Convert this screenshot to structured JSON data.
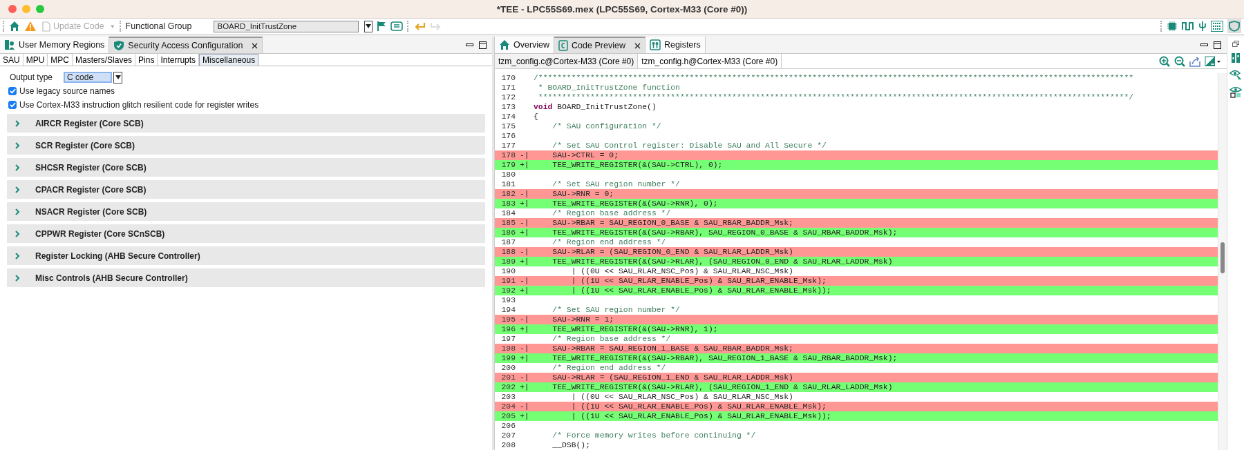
{
  "window": {
    "title": "*TEE - LPC55S69.mex (LPC55S69, Cortex-M33 (Core #0))"
  },
  "toolbar": {
    "update_code": {
      "label": "Update Code",
      "disabled": true,
      "caret": "▼"
    },
    "functional_group_label": "Functional Group",
    "functional_group": "BOARD_InitTrustZone"
  },
  "left_panel": {
    "tabs": [
      {
        "label": "User Memory Regions",
        "selected": false,
        "closable": false
      },
      {
        "label": "Security Access Configuration",
        "selected": true,
        "closable": true
      }
    ],
    "subtabs": [
      {
        "label": "SAU",
        "selected": false
      },
      {
        "label": "MPU",
        "selected": false
      },
      {
        "label": "MPC",
        "selected": false
      },
      {
        "label": "Masters/Slaves",
        "selected": false
      },
      {
        "label": "Pins",
        "selected": false
      },
      {
        "label": "Interrupts",
        "selected": false
      },
      {
        "label": "Miscellaneous",
        "selected": true
      }
    ],
    "output_type": {
      "label": "Output type",
      "value": "C code"
    },
    "options": [
      {
        "label": "Use legacy source names",
        "checked": true
      },
      {
        "label": "Use Cortex-M33 instruction glitch resilient code for register writes",
        "checked": true
      }
    ],
    "sections": [
      {
        "title": "AIRCR Register (Core SCB)",
        "expanded": false
      },
      {
        "title": "SCR Register (Core SCB)",
        "expanded": false
      },
      {
        "title": "SHCSR Register (Core SCB)",
        "expanded": false
      },
      {
        "title": "CPACR Register (Core SCB)",
        "expanded": false
      },
      {
        "title": "NSACR Register (Core SCB)",
        "expanded": false
      },
      {
        "title": "CPPWR Register (Core SCnSCB)",
        "expanded": false
      },
      {
        "title": "Register Locking (AHB Secure Controller)",
        "expanded": false
      },
      {
        "title": "Misc Controls (AHB Secure Controller)",
        "expanded": false
      }
    ]
  },
  "right_panel": {
    "tabs": [
      {
        "label": "Overview",
        "selected": false,
        "closable": false
      },
      {
        "label": "Code Preview",
        "selected": true,
        "closable": true
      },
      {
        "label": "Registers",
        "selected": false,
        "closable": false
      }
    ],
    "file_tabs": [
      {
        "label": "tzm_config.c@Cortex-M33 (Core #0)",
        "selected": true
      },
      {
        "label": "tzm_config.h@Cortex-M33 (Core #0)",
        "selected": false
      }
    ],
    "code_lines": [
      {
        "number": "170",
        "kind": "context",
        "comment": true,
        "code": "/******************************************************************************************************************************"
      },
      {
        "number": "171",
        "kind": "context",
        "comment": true,
        "code": " * BOARD_InitTrustZone function"
      },
      {
        "number": "172",
        "kind": "context",
        "comment": true,
        "code": " *****************************************************************************************************************************/"
      },
      {
        "number": "173",
        "kind": "context",
        "comment": false,
        "keyword": "void",
        "code": "BOARD_InitTrustZone()"
      },
      {
        "number": "174",
        "kind": "context",
        "comment": false,
        "code": "{"
      },
      {
        "number": "175",
        "kind": "context",
        "comment": true,
        "code": "    /* SAU configuration */"
      },
      {
        "number": "176",
        "kind": "context"
      },
      {
        "number": "177",
        "kind": "context",
        "comment": true,
        "code": "    /* Set SAU Control register: Disable SAU and All Secure */"
      },
      {
        "number": "178",
        "kind": "removed",
        "marker": "-|",
        "comment": false,
        "code": "    SAU->CTRL = 0;"
      },
      {
        "number": "179",
        "kind": "added",
        "marker": "+|",
        "comment": false,
        "code": "    TEE_WRITE_REGISTER(&(SAU->CTRL), 0);"
      },
      {
        "number": "180",
        "kind": "context"
      },
      {
        "number": "181",
        "kind": "context",
        "comment": true,
        "code": "    /* Set SAU region number */"
      },
      {
        "number": "182",
        "kind": "removed",
        "marker": "-|",
        "comment": false,
        "code": "    SAU->RNR = 0;"
      },
      {
        "number": "183",
        "kind": "added",
        "marker": "+|",
        "comment": false,
        "code": "    TEE_WRITE_REGISTER(&(SAU->RNR), 0);"
      },
      {
        "number": "184",
        "kind": "context",
        "comment": true,
        "code": "    /* Region base address */"
      },
      {
        "number": "185",
        "kind": "removed",
        "marker": "-|",
        "comment": false,
        "code": "    SAU->RBAR = SAU_REGION_0_BASE & SAU_RBAR_BADDR_Msk;"
      },
      {
        "number": "186",
        "kind": "added",
        "marker": "+|",
        "comment": false,
        "code": "    TEE_WRITE_REGISTER(&(SAU->RBAR), SAU_REGION_0_BASE & SAU_RBAR_BADDR_Msk);"
      },
      {
        "number": "187",
        "kind": "context",
        "comment": true,
        "code": "    /* Region end address */"
      },
      {
        "number": "188",
        "kind": "removed",
        "marker": "-|",
        "comment": false,
        "code": "    SAU->RLAR = (SAU_REGION_0_END & SAU_RLAR_LADDR_Msk)"
      },
      {
        "number": "189",
        "kind": "added",
        "marker": "+|",
        "comment": false,
        "code": "    TEE_WRITE_REGISTER(&(SAU->RLAR), (SAU_REGION_0_END & SAU_RLAR_LADDR_Msk)"
      },
      {
        "number": "190",
        "kind": "context",
        "comment": false,
        "code": "        | ((0U << SAU_RLAR_NSC_Pos) & SAU_RLAR_NSC_Msk)"
      },
      {
        "number": "191",
        "kind": "removed",
        "marker": "-|",
        "comment": false,
        "code": "        | ((1U << SAU_RLAR_ENABLE_Pos) & SAU_RLAR_ENABLE_Msk);"
      },
      {
        "number": "192",
        "kind": "added",
        "marker": "+|",
        "comment": false,
        "code": "        | ((1U << SAU_RLAR_ENABLE_Pos) & SAU_RLAR_ENABLE_Msk));"
      },
      {
        "number": "193",
        "kind": "context"
      },
      {
        "number": "194",
        "kind": "context",
        "comment": true,
        "code": "    /* Set SAU region number */"
      },
      {
        "number": "195",
        "kind": "removed",
        "marker": "-|",
        "comment": false,
        "code": "    SAU->RNR = 1;"
      },
      {
        "number": "196",
        "kind": "added",
        "marker": "+|",
        "comment": false,
        "code": "    TEE_WRITE_REGISTER(&(SAU->RNR), 1);"
      },
      {
        "number": "197",
        "kind": "context",
        "comment": true,
        "code": "    /* Region base address */"
      },
      {
        "number": "198",
        "kind": "removed",
        "marker": "-|",
        "comment": false,
        "code": "    SAU->RBAR = SAU_REGION_1_BASE & SAU_RBAR_BADDR_Msk;"
      },
      {
        "number": "199",
        "kind": "added",
        "marker": "+|",
        "comment": false,
        "code": "    TEE_WRITE_REGISTER(&(SAU->RBAR), SAU_REGION_1_BASE & SAU_RBAR_BADDR_Msk);"
      },
      {
        "number": "200",
        "kind": "context",
        "comment": true,
        "code": "    /* Region end address */"
      },
      {
        "number": "201",
        "kind": "removed",
        "marker": "-|",
        "comment": false,
        "code": "    SAU->RLAR = (SAU_REGION_1_END & SAU_RLAR_LADDR_Msk)"
      },
      {
        "number": "202",
        "kind": "added",
        "marker": "+|",
        "comment": false,
        "code": "    TEE_WRITE_REGISTER(&(SAU->RLAR), (SAU_REGION_1_END & SAU_RLAR_LADDR_Msk)"
      },
      {
        "number": "203",
        "kind": "context",
        "comment": false,
        "code": "        | ((0U << SAU_RLAR_NSC_Pos) & SAU_RLAR_NSC_Msk)"
      },
      {
        "number": "204",
        "kind": "removed",
        "marker": "-|",
        "comment": false,
        "code": "        | ((1U << SAU_RLAR_ENABLE_Pos) & SAU_RLAR_ENABLE_Msk);"
      },
      {
        "number": "205",
        "kind": "added",
        "marker": "+|",
        "comment": false,
        "code": "        | ((1U << SAU_RLAR_ENABLE_Pos) & SAU_RLAR_ENABLE_Msk));"
      },
      {
        "number": "206",
        "kind": "context"
      },
      {
        "number": "207",
        "kind": "context",
        "comment": true,
        "code": "    /* Force memory writes before continuing */"
      },
      {
        "number": "208",
        "kind": "context",
        "comment": false,
        "code": "    __DSB();"
      }
    ]
  }
}
